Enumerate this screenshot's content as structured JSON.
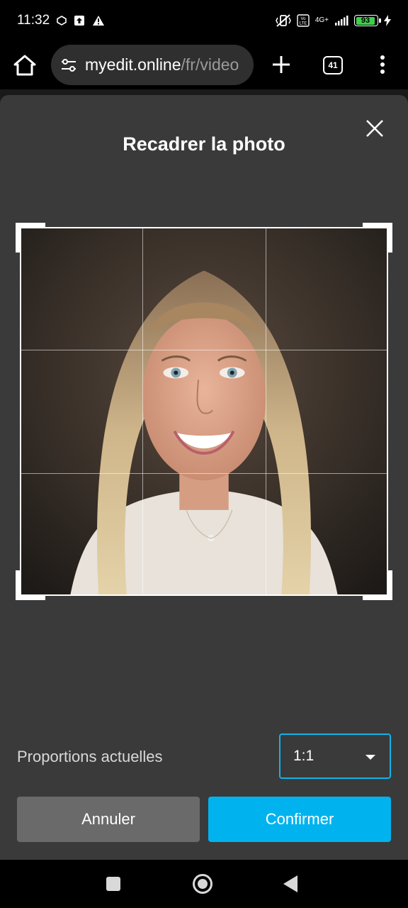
{
  "status_bar": {
    "time": "11:32",
    "volte_label": "Vo\nLTE",
    "network_label": "4G+",
    "battery_level": "93"
  },
  "browser": {
    "url_host": "myedit.online",
    "url_path": "/fr/video",
    "tab_count": "41"
  },
  "dialog": {
    "title": "Recadrer la photo",
    "ratio_label": "Proportions actuelles",
    "ratio_value": "1:1",
    "cancel_label": "Annuler",
    "confirm_label": "Confirmer"
  },
  "colors": {
    "accent": "#00b3ee",
    "dialog_bg": "#3a3a3a",
    "cancel_bg": "#6a6a6a"
  }
}
